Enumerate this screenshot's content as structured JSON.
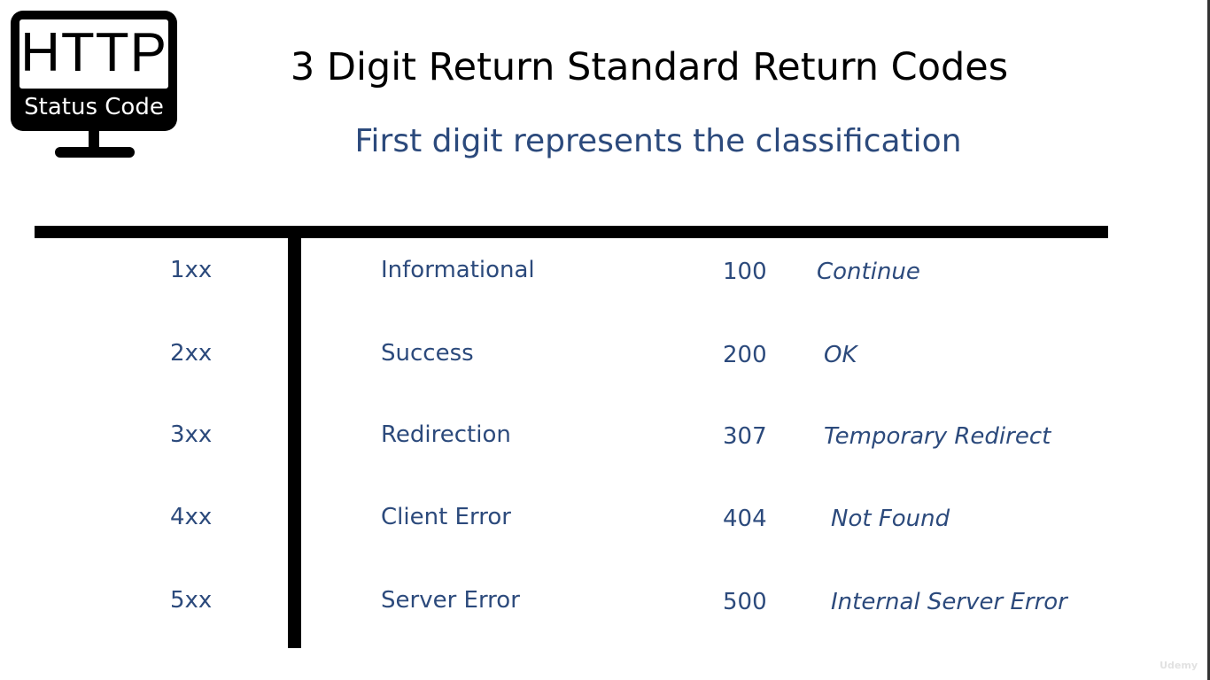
{
  "logo": {
    "top_text": "HTTP",
    "bottom_text": "Status Code"
  },
  "title": "3 Digit Return Standard Return Codes",
  "subtitle": "First digit represents the classification",
  "rows": [
    {
      "class": "1xx",
      "name": "Informational",
      "code": "100",
      "example": "Continue"
    },
    {
      "class": "2xx",
      "name": "Success",
      "code": "200",
      "example": "OK"
    },
    {
      "class": "3xx",
      "name": "Redirection",
      "code": "307",
      "example": "Temporary Redirect"
    },
    {
      "class": "4xx",
      "name": "Client Error",
      "code": "404",
      "example": "Not Found"
    },
    {
      "class": "5xx",
      "name": "Server Error",
      "code": "500",
      "example": "Internal Server Error"
    }
  ],
  "watermark": "Udemy",
  "colors": {
    "text_blue": "#2c4a7c",
    "black": "#000000"
  }
}
